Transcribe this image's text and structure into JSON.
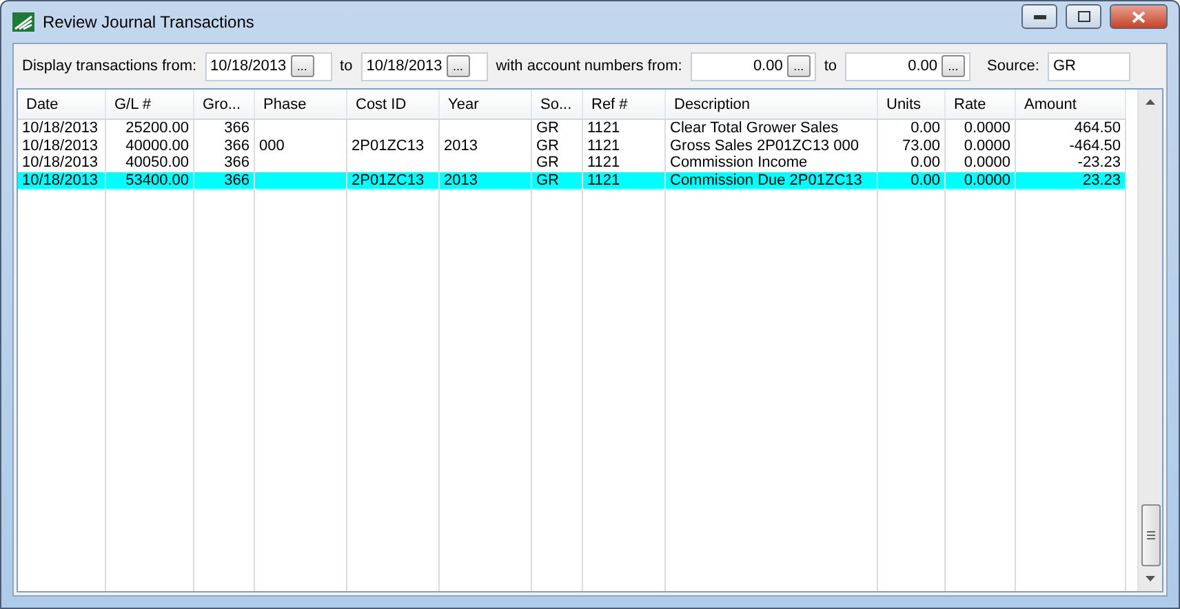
{
  "window": {
    "title": "Review Journal Transactions"
  },
  "filter": {
    "from_label": "Display transactions from:",
    "from_date": "10/18/2013",
    "browse": "...",
    "to_label": "to",
    "to_date": "10/18/2013",
    "account_label": "with account numbers from:",
    "account_from": "0.00",
    "account_to_label": "to",
    "account_to": "0.00",
    "source_label": "Source:",
    "source": "GR"
  },
  "table": {
    "columns": [
      "Date",
      "G/L #",
      "Gro...",
      "Phase",
      "Cost ID",
      "Year",
      "So...",
      "Ref #",
      "Description",
      "Units",
      "Rate",
      "Amount"
    ],
    "rows": [
      {
        "selected": false,
        "cells": [
          "10/18/2013",
          "25200.00",
          "366",
          "",
          "",
          "",
          "GR",
          "1121",
          "Clear Total Grower Sales",
          "0.00",
          "0.0000",
          "464.50"
        ]
      },
      {
        "selected": false,
        "cells": [
          "10/18/2013",
          "40000.00",
          "366",
          "000",
          "2P01ZC13",
          "2013",
          "GR",
          "1121",
          "Gross Sales 2P01ZC13 000",
          "73.00",
          "0.0000",
          "-464.50"
        ]
      },
      {
        "selected": false,
        "cells": [
          "10/18/2013",
          "40050.00",
          "366",
          "",
          "",
          "",
          "GR",
          "1121",
          "Commission Income",
          "0.00",
          "0.0000",
          "-23.23"
        ]
      },
      {
        "selected": true,
        "cells": [
          "10/18/2013",
          "53400.00",
          "366",
          "",
          "2P01ZC13",
          "2013",
          "GR",
          "1121",
          "Commission Due 2P01ZC13",
          "0.00",
          "0.0000",
          "23.23"
        ]
      }
    ]
  }
}
